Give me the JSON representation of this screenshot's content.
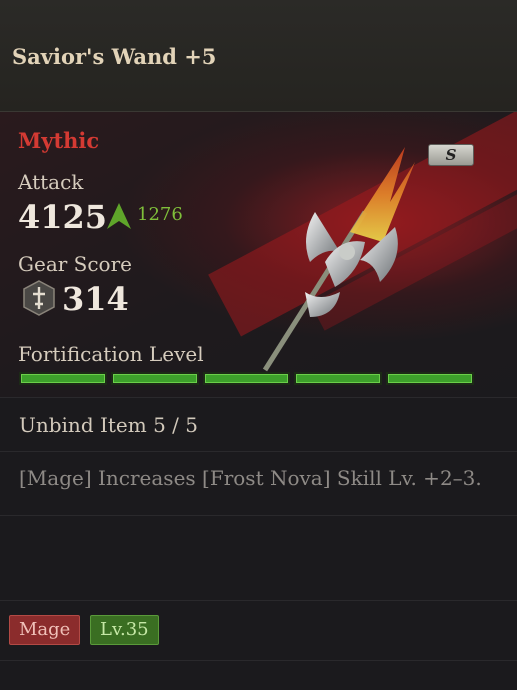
{
  "header": {
    "title": "Savior's Wand +5"
  },
  "item": {
    "rarity": "Mythic",
    "grade": "S",
    "attack_label": "Attack",
    "attack_value": "4125",
    "attack_delta": "1276",
    "gear_score_label": "Gear Score",
    "gear_score_value": "314",
    "fortification_label": "Fortification Level",
    "fortification_segments_filled": 5,
    "fortification_segments_total": 5
  },
  "details": {
    "unbind": "Unbind Item 5 / 5",
    "effect": "[Mage] Increases [Frost Nova] Skill Lv. +2–3."
  },
  "tags": {
    "class": "Mage",
    "level": "Lv.35"
  },
  "colors": {
    "rarity": "#d43a33",
    "delta": "#7fbf3a",
    "bar": "#3da02b"
  }
}
